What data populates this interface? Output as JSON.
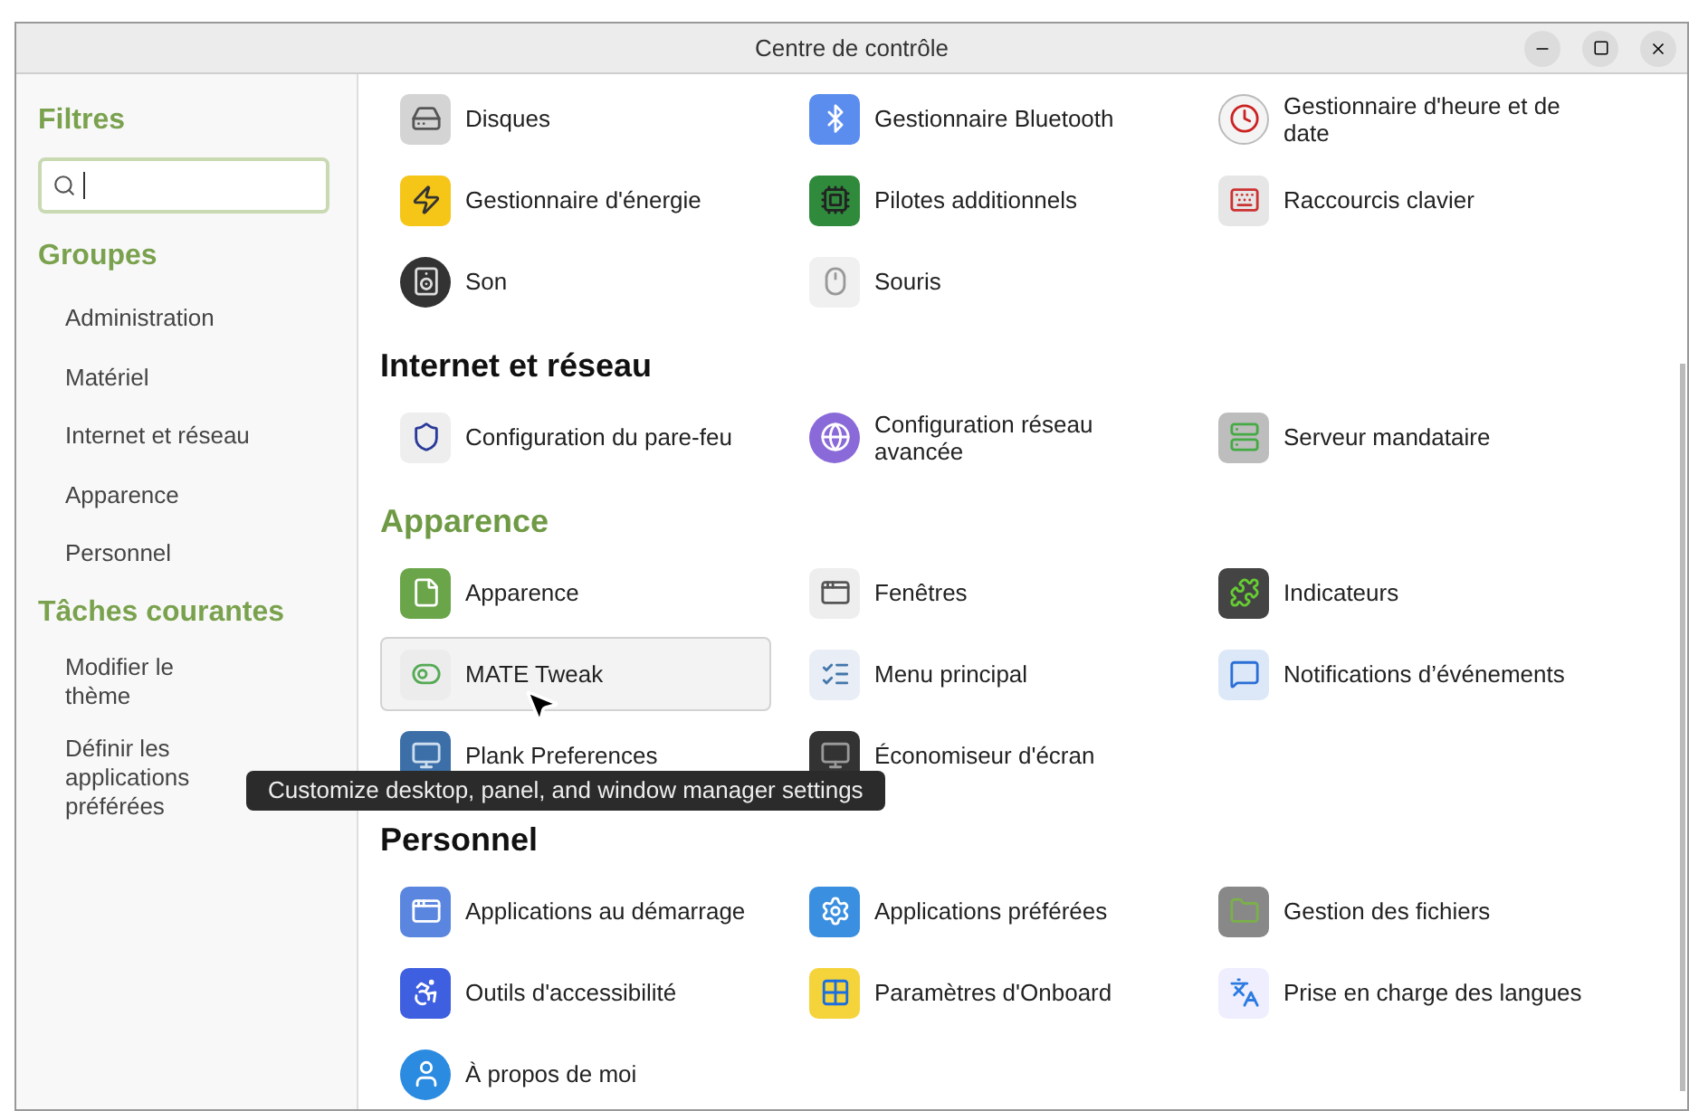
{
  "window": {
    "title": "Centre de contrôle"
  },
  "sidebar": {
    "filters_title": "Filtres",
    "groups_title": "Groupes",
    "groups": [
      "Administration",
      "Matériel",
      "Internet et réseau",
      "Apparence",
      "Personnel"
    ],
    "tasks_title": "Tâches courantes",
    "tasks": [
      "Modifier le thème",
      "Définir les applications préférées"
    ]
  },
  "sections": [
    {
      "items": [
        {
          "label": "Disques",
          "hovered": false
        },
        {
          "label": "Gestionnaire Bluetooth",
          "hovered": false
        },
        {
          "label": "Gestionnaire d'heure et de date",
          "hovered": false
        },
        {
          "label": "Gestionnaire d'énergie",
          "hovered": false
        },
        {
          "label": "Pilotes additionnels",
          "hovered": false
        },
        {
          "label": "Raccourcis clavier",
          "hovered": false
        },
        {
          "label": "Son",
          "hovered": false
        },
        {
          "label": "Souris",
          "hovered": false
        }
      ]
    },
    {
      "title": "Internet et réseau",
      "highlighted": false,
      "items": [
        {
          "label": "Configuration du pare-feu",
          "hovered": false
        },
        {
          "label": "Configuration réseau avancée",
          "hovered": false
        },
        {
          "label": "Serveur mandataire",
          "hovered": false
        }
      ]
    },
    {
      "title": "Apparence",
      "highlighted": true,
      "items": [
        {
          "label": "Apparence",
          "hovered": false
        },
        {
          "label": "Fenêtres",
          "hovered": false
        },
        {
          "label": "Indicateurs",
          "hovered": false
        },
        {
          "label": "MATE Tweak",
          "hovered": true
        },
        {
          "label": "Menu principal",
          "hovered": false
        },
        {
          "label": "Notifications d’événements",
          "hovered": false
        },
        {
          "label": "Plank Preferences",
          "hovered": false
        },
        {
          "label": "Économiseur d'écran",
          "hovered": false
        }
      ]
    },
    {
      "title": "Personnel",
      "highlighted": false,
      "items": [
        {
          "label": "Applications au démarrage",
          "hovered": false
        },
        {
          "label": "Applications préférées",
          "hovered": false
        },
        {
          "label": "Gestion des fichiers",
          "hovered": false
        },
        {
          "label": "Outils d'accessibilité",
          "hovered": false
        },
        {
          "label": "Paramètres d'Onboard",
          "hovered": false
        },
        {
          "label": "Prise en charge des langues",
          "hovered": false
        },
        {
          "label": "À propos de moi",
          "hovered": false
        }
      ]
    }
  ],
  "tooltip": "Customize desktop, panel, and window manager settings"
}
